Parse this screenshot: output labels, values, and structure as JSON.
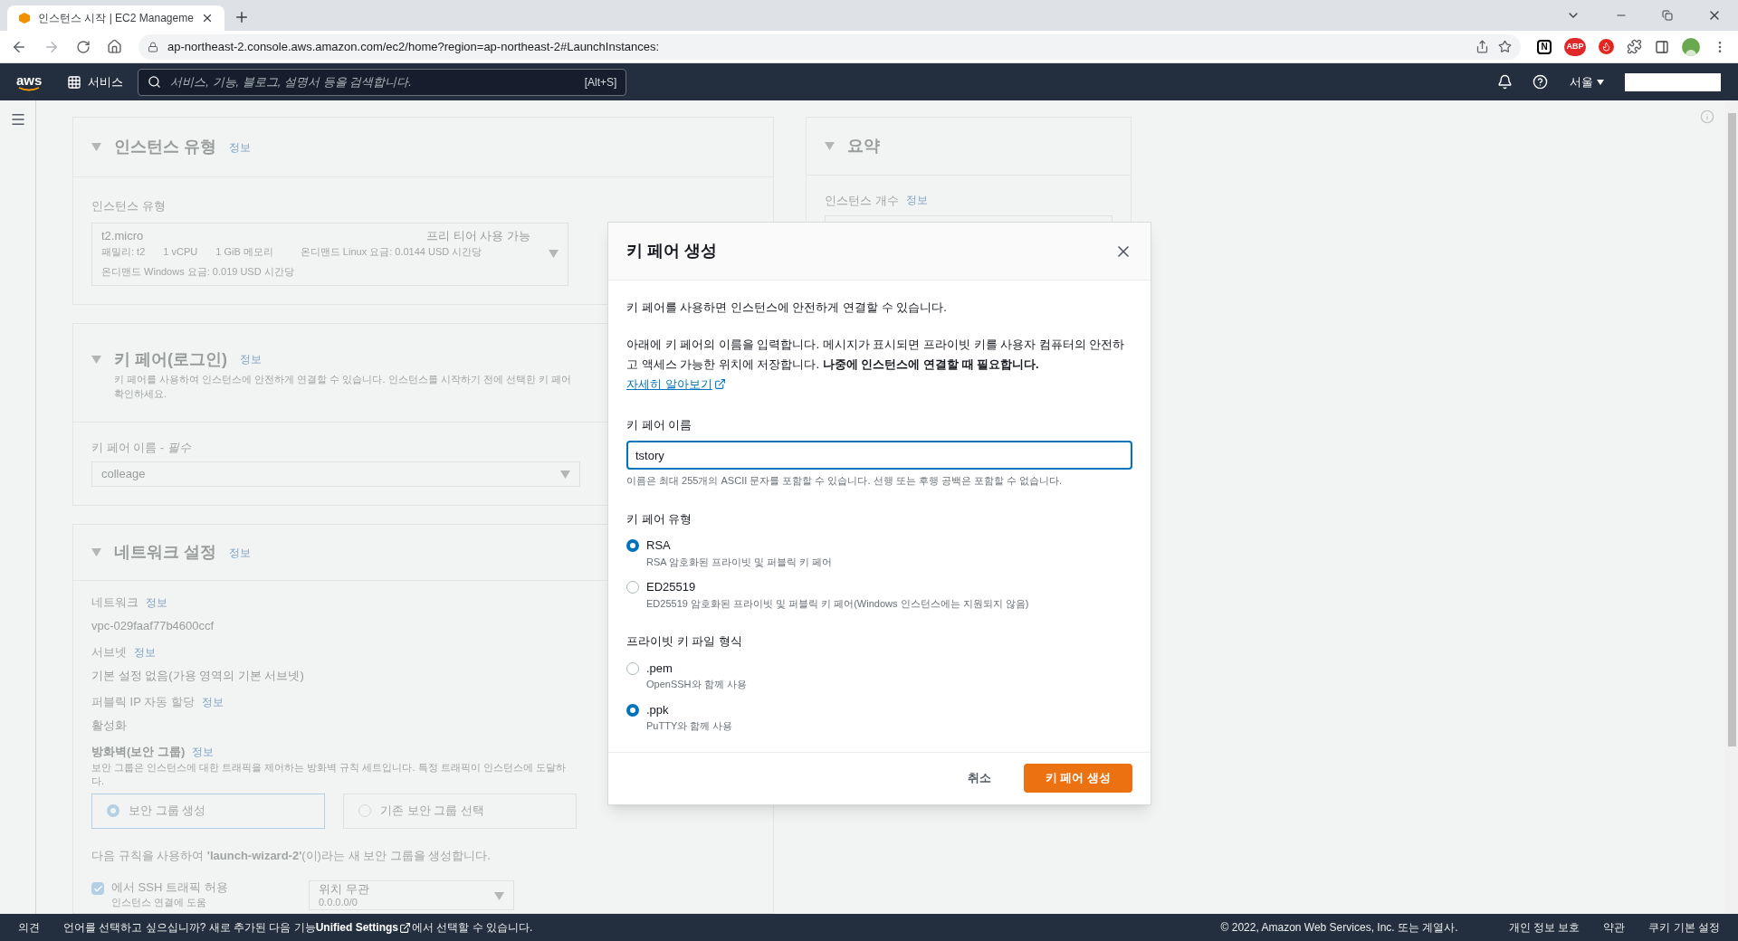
{
  "browser": {
    "tab_title": "인스턴스 시작 | EC2 Manageme",
    "url": "ap-northeast-2.console.aws.amazon.com/ec2/home?region=ap-northeast-2#LaunchInstances:"
  },
  "extensions": [
    {
      "kind": "letter",
      "label": "N"
    },
    {
      "kind": "stop",
      "label": "ABP"
    },
    {
      "kind": "flame"
    },
    {
      "kind": "puzzle"
    }
  ],
  "aws_nav": {
    "logo": "aws",
    "services": "서비스",
    "search_placeholder": "서비스, 기능, 블로그, 설명서 등을 검색합니다.",
    "shortcut": "[Alt+S]",
    "region": "서울"
  },
  "instance_type": {
    "title": "인스턴스 유형",
    "info": "정보",
    "field_label": "인스턴스 유형",
    "name": "t2.micro",
    "family": "패밀리: t2",
    "vcpu": "1 vCPU",
    "memory": "1 GiB 메모리",
    "linux_price": "온디맨드 Linux 요금: 0.0144 USD 시간당",
    "windows_price": "온디맨드 Windows 요금: 0.019 USD 시간당",
    "badge": "프리 티어 사용 가능"
  },
  "key_pair_section": {
    "title": "키 페어(로그인)",
    "info": "정보",
    "description_lines": [
      "키 페어를 사용하여 인스턴스에 안전하게 연결할 수 있습니다. 인스턴스를 시작하기 전에 선택한 키 페어",
      "확인하세요."
    ],
    "field_label": "키 페어 이름 - ",
    "field_required": "필수",
    "value": "colleage"
  },
  "network": {
    "title": "네트워크 설정",
    "info": "정보",
    "fields": [
      {
        "label": "네트워크",
        "info": "정보",
        "value": "vpc-029faaf77b4600ccf"
      },
      {
        "label": "서브넷",
        "info": "정보",
        "value": "기본 설정 없음(가용 영역의 기본 서브넷)"
      },
      {
        "label": "퍼블릭 IP 자동 할당",
        "info": "정보",
        "value": "활성화"
      }
    ],
    "firewall": {
      "title": "방화벽(보안 그룹)",
      "info": "정보",
      "description_lines": [
        "보안 그룹은 인스턴스에 대한 트래픽을 제어하는 방화벽 규칙 세트입니다. 특정 트래픽이 인스턴스에 도달하",
        "다."
      ],
      "options": [
        {
          "label": "보안 그룹 생성",
          "selected": true
        },
        {
          "label": "기존 보안 그룹 선택",
          "selected": false
        }
      ],
      "note": "다음 규칙을 사용하여 **'launch-wizard-2'**(이)라는 새 보안 그룹을 생성합니다.",
      "ssh": {
        "checked": true,
        "label": "에서 SSH 트래픽 허용",
        "hint": "인스턴스 연결에 도움",
        "source": "위치 무관",
        "cidr": "0.0.0.0/0"
      }
    }
  },
  "summary": {
    "title": "요약",
    "field_label": "인스턴스 개수",
    "info": "정보"
  },
  "modal": {
    "title": "키 페어 생성",
    "intro": "키 페어를 사용하면 인스턴스에 안전하게 연결할 수 있습니다.",
    "instructions": "아래에 키 페어의 이름을 입력합니다. 메시지가 표시되면 프라이빗 키를 사용자 컴퓨터의 안전하고 액세스 가능한 위치에 저장합니다. **나중에 인스턴스에 연결할 때 필요합니다.**",
    "learn_more": "자세히 알아보기",
    "name_label": "키 페어 이름",
    "name_value": "tstory",
    "name_hint": "이름은 최대 255개의 ASCII 문자를 포함할 수 있습니다. 선행 또는 후행 공백은 포함할 수 없습니다.",
    "key_type": {
      "label": "키 페어 유형",
      "options": [
        {
          "label": "RSA",
          "description": "RSA 암호화된 프라이빗 및 퍼블릭 키 페어",
          "selected": true
        },
        {
          "label": "ED25519",
          "description": "ED25519 암호화된 프라이빗 및 퍼블릭 키 페어(Windows 인스턴스에는 지원되지 않음)",
          "selected": false
        }
      ]
    },
    "file_format": {
      "label": "프라이빗 키 파일 형식",
      "options": [
        {
          "label": ".pem",
          "description": "OpenSSH와 함께 사용",
          "selected": false
        },
        {
          "label": ".ppk",
          "description": "PuTTY와 함께 사용",
          "selected": true
        }
      ]
    },
    "cancel": "취소",
    "create": "키 페어 생성"
  },
  "footer": {
    "feedback": "의견",
    "language_prefix": "언어를 선택하고 싶으십니까? 새로 추가된 다음 기능",
    "language_link": "Unified Settings",
    "language_suffix": "에서 선택할 수 있습니다.",
    "copyright": "© 2022, Amazon Web Services, Inc. 또는 계열사.",
    "links": [
      "개인 정보 보호",
      "약관",
      "쿠키 기본 설정"
    ]
  }
}
